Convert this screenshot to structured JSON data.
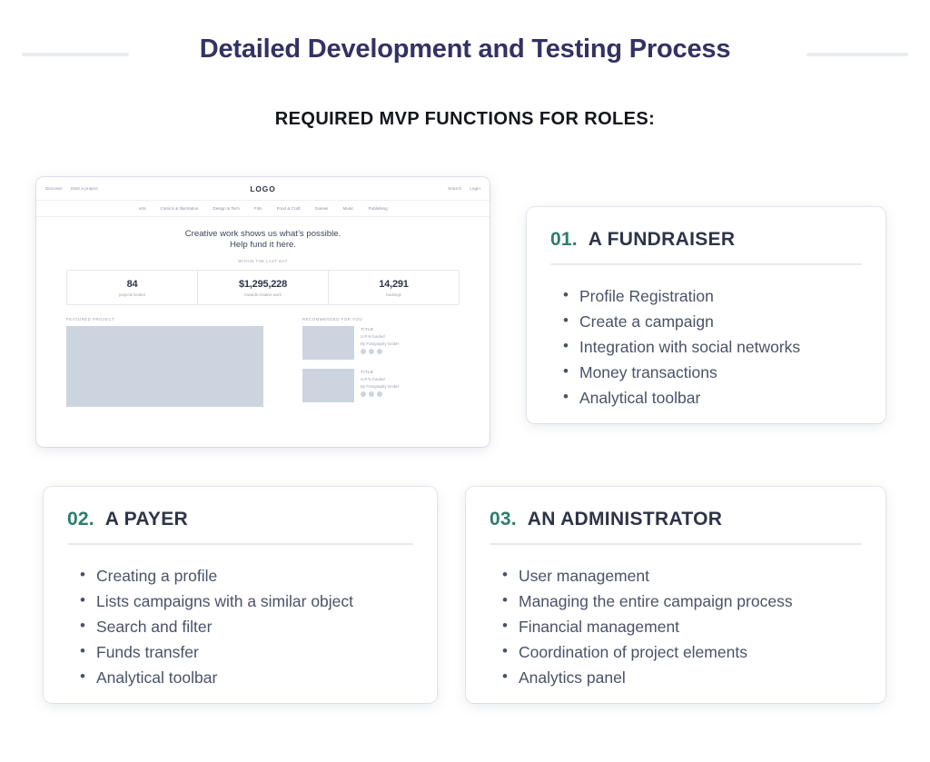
{
  "header": {
    "title": "Detailed Development and Testing Process",
    "subtitle": "REQUIRED MVP FUNCTIONS FOR ROLES:"
  },
  "colors": {
    "title_navy": "#323263",
    "accent_teal": "#2d7d6e",
    "card_title": "#2e3448",
    "body_text": "#4a5268",
    "rule": "#e9ecf1",
    "placeholder": "#ccd5df"
  },
  "mockup": {
    "topbar": {
      "left_links": [
        "Discover",
        "Start a project"
      ],
      "logo": "LOGO",
      "right_links": [
        "Search",
        "Login"
      ]
    },
    "categories": [
      "Arts",
      "Comics & Illustration",
      "Design & Tech",
      "Film",
      "Food & Craft",
      "Games",
      "Music",
      "Publishing"
    ],
    "hero": {
      "line1": "Creative work shows us what’s possible.",
      "line2": "Help fund it here."
    },
    "stats_label": "WITHIN THE LAST DAY",
    "stats": [
      {
        "value": "84",
        "label": "projects funded"
      },
      {
        "value": "$1,295,228",
        "label": "towards creative work"
      },
      {
        "value": "14,291",
        "label": "backings"
      }
    ],
    "featured_label": "FEATURED PROJECT",
    "recommended_label": "RECOMMENDED FOR YOU",
    "recommended": [
      {
        "title": "TITLE",
        "funded": "U.P.% funded",
        "by": "By Fotography GmbH"
      },
      {
        "title": "TITLE",
        "funded": "U.P.% funded",
        "by": "By Fotography GmbH"
      }
    ]
  },
  "cards": [
    {
      "number": "01.",
      "title": "A FUNDRAISER",
      "items": [
        "Profile Registration",
        "Create a campaign",
        "Integration with social networks",
        "Money transactions",
        "Analytical toolbar"
      ]
    },
    {
      "number": "02.",
      "title": "A PAYER",
      "items": [
        "Creating a profile",
        "Lists campaigns with a similar object",
        "Search and filter",
        "Funds transfer",
        "Analytical toolbar"
      ]
    },
    {
      "number": "03.",
      "title": "AN ADMINISTRATOR",
      "items": [
        "User management",
        "Managing the entire campaign process",
        "Financial management",
        "Coordination of project elements",
        "Analytics panel"
      ]
    }
  ]
}
